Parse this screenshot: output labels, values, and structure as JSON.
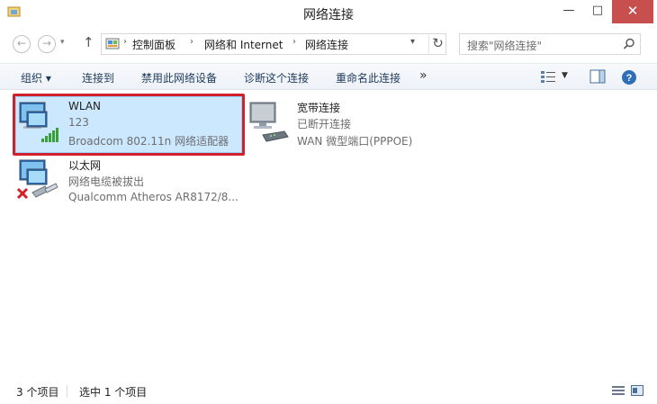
{
  "window": {
    "title": "网络连接",
    "buttons": {
      "minimize": "—",
      "maximize": "□",
      "close": "✕"
    }
  },
  "address": {
    "breadcrumbs": [
      "控制面板",
      "网络和 Internet",
      "网络连接"
    ],
    "separator": "›"
  },
  "search": {
    "placeholder": "搜索\"网络连接\""
  },
  "toolbar": {
    "organize": "组织 ▾",
    "connect_to": "连接到",
    "disable": "禁用此网络设备",
    "diagnose": "诊断这个连接",
    "rename": "重命名此连接",
    "more": "»"
  },
  "connections": [
    {
      "name": "WLAN",
      "status": "123",
      "adapter": "Broadcom 802.11n 网络适配器",
      "icon": "wifi-signal-icon"
    },
    {
      "name": "宽带连接",
      "status": "已断开连接",
      "adapter": "WAN 微型端口(PPPOE)",
      "icon": "modem-icon"
    },
    {
      "name": "以太网",
      "status": "网络电缆被拔出",
      "adapter": "Qualcomm Atheros AR8172/8...",
      "icon": "ethernet-cable-icon"
    }
  ],
  "status": {
    "count": "3 个项目",
    "selected": "选中 1 个项目"
  },
  "colors": {
    "selection": "#cce8ff",
    "highlight_frame": "#d0202a",
    "close_button": "#c7504f"
  }
}
